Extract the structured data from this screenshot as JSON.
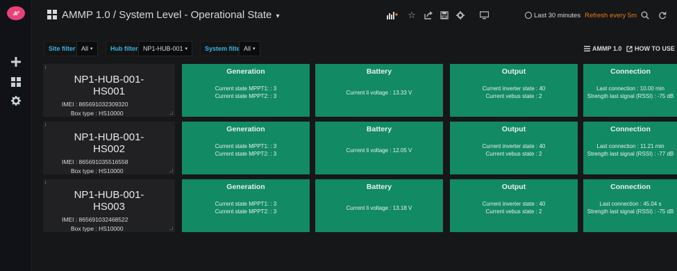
{
  "app": {
    "logo_text": ".ılı°",
    "dashboard_title": "AMMP 1.0 / System Level - Operational State",
    "title_caret": "▾"
  },
  "sidebar": {
    "icons": [
      "plus-icon",
      "dashboards-icon",
      "gear-icon"
    ]
  },
  "navbar": {
    "time_range": "Last 30 minutes",
    "refresh": "Refresh every 5m"
  },
  "filters": {
    "site_label": "Site filter",
    "site_value": "All",
    "hub_label": "Hub filter",
    "hub_value": "NP1-HUB-001",
    "system_label": "System filter",
    "system_value": "All",
    "caret": "▾"
  },
  "links": {
    "ammp": "AMMP 1.0",
    "howto": "HOW TO USE"
  },
  "rows": [
    {
      "hub": {
        "name_line1": "NP1-HUB-001-",
        "name_line2": "HS001",
        "imei": "IMEI : 865691032309320",
        "box": "Box type : HS10000"
      },
      "generation": {
        "title": "Generation",
        "line1": "Current state MPPT1: : 3",
        "line2": "Current state MPPT2: : 3"
      },
      "battery": {
        "title": "Battery",
        "line1": "Current li voltage : 13.33 V"
      },
      "output": {
        "title": "Output",
        "line1": "Current inverter state : 40",
        "line2": "Current vebus state : 2"
      },
      "connection": {
        "title": "Connection",
        "line1": "Last connection : 10.00 min",
        "line2": "Strength last signal (RSSI) : -75 dB"
      }
    },
    {
      "hub": {
        "name_line1": "NP1-HUB-001-",
        "name_line2": "HS002",
        "imei": "IMEI : 865691035516558",
        "box": "Box type : HS10000"
      },
      "generation": {
        "title": "Generation",
        "line1": "Current state MPPT1: : 3",
        "line2": "Current state MPPT2: : 3"
      },
      "battery": {
        "title": "Battery",
        "line1": "Current li voltage : 12.05 V"
      },
      "output": {
        "title": "Output",
        "line1": "Current inverter state : 40",
        "line2": "Current vebus state : 2"
      },
      "connection": {
        "title": "Connection",
        "line1": "Last connection : 11.21 min",
        "line2": "Strength last signal (RSSI) : -77 dB"
      }
    },
    {
      "hub": {
        "name_line1": "NP1-HUB-001-",
        "name_line2": "HS003",
        "imei": "IMEI : 865691032468522",
        "box": "Box type : HS10000"
      },
      "generation": {
        "title": "Generation",
        "line1": "Current state MPPT1: : 3",
        "line2": "Current state MPPT2: : 3"
      },
      "battery": {
        "title": "Battery",
        "line1": "Current li voltage : 13.18 V"
      },
      "output": {
        "title": "Output",
        "line1": "Current inverter state : 40",
        "line2": "Current vebus state : 2"
      },
      "connection": {
        "title": "Connection",
        "line1": "Last connection : 45.04 s",
        "line2": "Strength last signal (RSSI) : -75 dB"
      }
    }
  ],
  "colors": {
    "stat_bg": "#128a63",
    "accent_orange": "#eb7b18",
    "filter_label": "#33b5e5",
    "logo": "#e8417a"
  }
}
